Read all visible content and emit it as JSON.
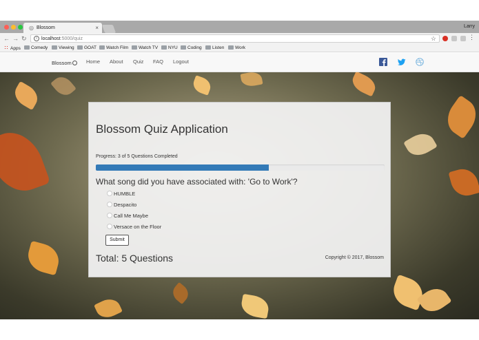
{
  "browser": {
    "tab_title": "Blossom",
    "tab_close": "×",
    "profile_name": "Larry",
    "url_host": "localhost",
    "url_path": ":5000/quiz",
    "bookmarks": [
      "Apps",
      "Comedy",
      "Viewing",
      "GOAT",
      "Watch Film",
      "Watch TV",
      "NYU",
      "Coding",
      "Listen",
      "Work"
    ]
  },
  "navbar": {
    "brand": "Blossom",
    "links": [
      "Home",
      "About",
      "Quiz",
      "FAQ",
      "Logout"
    ],
    "social_icons": [
      "facebook-icon",
      "twitter-icon",
      "dribbble-icon"
    ],
    "colors": {
      "facebook": "#3b5998",
      "twitter": "#1da1f2",
      "dribbble": "#7fb8e0"
    }
  },
  "quiz": {
    "title": "Blossom Quiz Application",
    "progress_text": "Progress: 3 of 5 Questions Completed",
    "progress_fraction": 0.6,
    "progress_color": "#337ab7",
    "question": "What song did you have associated with: 'Go to Work'?",
    "options": [
      "HUMBLE",
      "Despacito",
      "Call Me Maybe",
      "Versace on the Floor"
    ],
    "submit_label": "Submit",
    "total": "Total: 5 Questions",
    "copyright": "Copyright © 2017, Blossom"
  }
}
